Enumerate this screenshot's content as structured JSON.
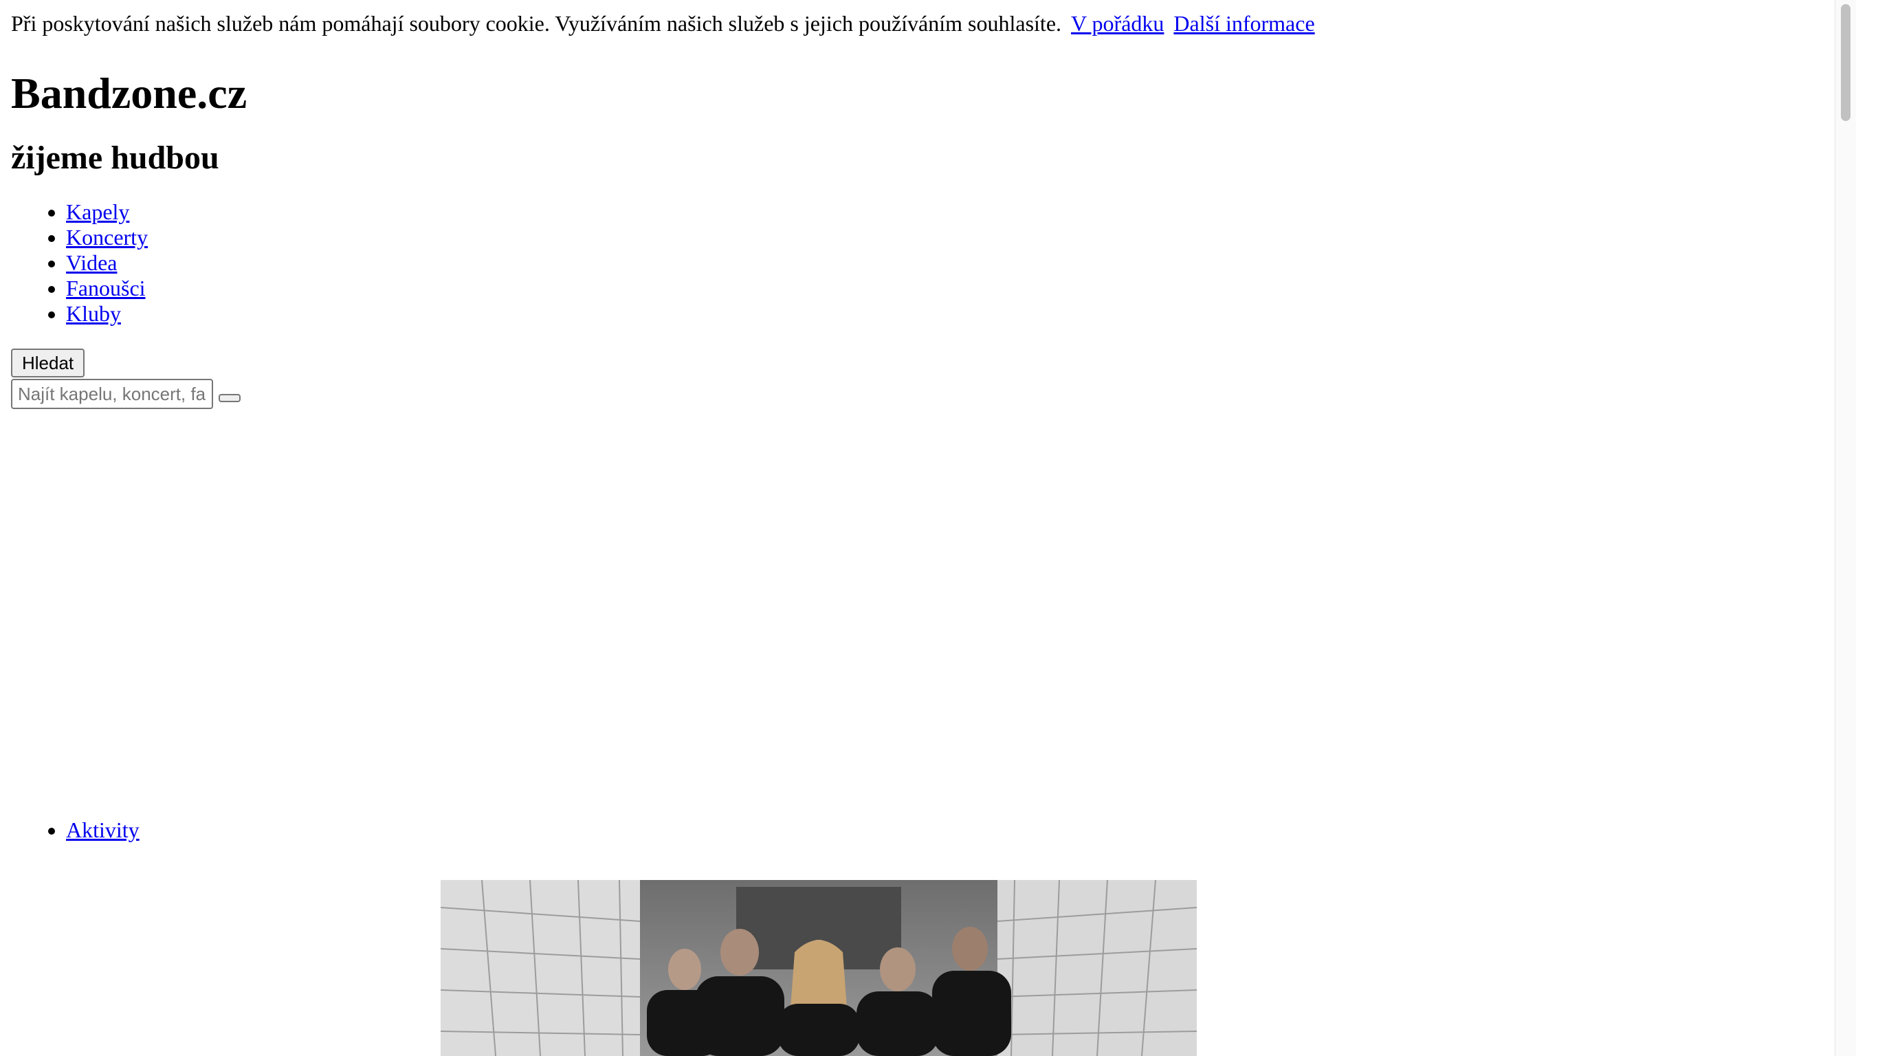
{
  "cookie_bar": {
    "text": "Při poskytování našich služeb nám pomáhají soubory cookie. Využíváním našich služeb s jejich používáním souhlasíte.",
    "ok_link": "V pořádku",
    "more_link": "Další informace"
  },
  "header": {
    "title": "Bandzone.cz",
    "subtitle": "žijeme hudbou"
  },
  "nav": {
    "items": [
      {
        "label": "Kapely"
      },
      {
        "label": "Koncerty"
      },
      {
        "label": "Videa"
      },
      {
        "label": "Fanoušci"
      },
      {
        "label": "Kluby"
      }
    ]
  },
  "search": {
    "toggle_label": "Hledat",
    "placeholder": "Najít kapelu, koncert, fanouška...",
    "submit_label": ""
  },
  "tabs": {
    "items": [
      {
        "label": "Aktivity"
      }
    ]
  },
  "feature": {
    "image_description": "band-photo"
  }
}
